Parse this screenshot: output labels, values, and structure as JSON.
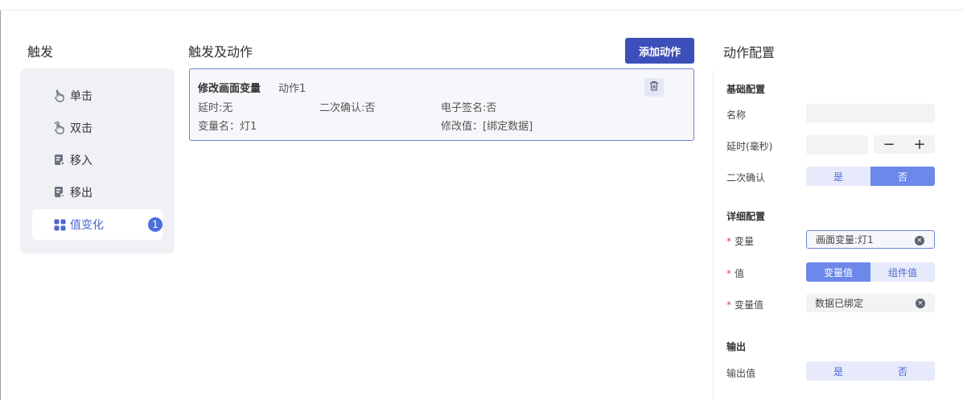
{
  "trigger": {
    "title": "触发",
    "items": [
      {
        "label": "单击",
        "icon": "tap-icon"
      },
      {
        "label": "双击",
        "icon": "double-tap-icon"
      },
      {
        "label": "移入",
        "icon": "move-in-icon"
      },
      {
        "label": "移出",
        "icon": "move-out-icon"
      },
      {
        "label": "值变化",
        "icon": "grid-icon",
        "badge": "1",
        "active": true
      }
    ]
  },
  "actions": {
    "title": "触发及动作",
    "add_label": "添加动作",
    "card": {
      "title": "修改画面变量",
      "subtitle": "动作1",
      "delay": "延时:无",
      "confirm": "二次确认:否",
      "signature": "电子签名:否",
      "var_name": "变量名：灯1",
      "new_value": "修改值：[绑定数据]"
    }
  },
  "config": {
    "title": "动作配置",
    "basic_label": "基础配置",
    "name_label": "名称",
    "name_value": "",
    "delay_label": "延时(毫秒)",
    "delay_value": "",
    "minus": "−",
    "plus": "+",
    "confirm_label": "二次确认",
    "confirm_yes": "是",
    "confirm_no": "否",
    "detail_label": "详细配置",
    "required_mark": "*",
    "variable_label": "变量",
    "variable_value": "画面变量:灯1",
    "value_label": "值",
    "value_opt1": "变量值",
    "value_opt2": "组件值",
    "varval_label": "变量值",
    "varval_value": "数据已绑定",
    "clear_glyph": "×",
    "output_section": "输出",
    "output_label": "输出值",
    "output_yes": "是",
    "output_no": "否"
  },
  "colors": {
    "primary": "#3d4fb8",
    "accent": "#4c66d6",
    "segment_active": "#6b88ea",
    "segment_inactive": "#e6eafa",
    "required": "#e04848"
  }
}
